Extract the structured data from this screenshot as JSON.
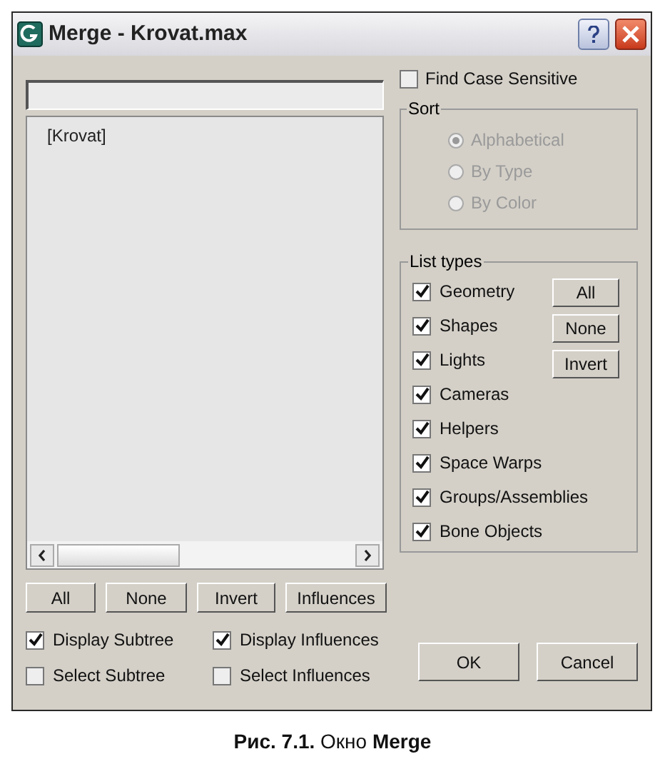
{
  "window": {
    "title": "Merge - Krovat.max"
  },
  "objects": [
    {
      "label": "[Krovat]",
      "selected": false
    }
  ],
  "find_case_sensitive": {
    "label": "Find Case Sensitive",
    "checked": false
  },
  "sort": {
    "title": "Sort",
    "disabled": true,
    "options": [
      {
        "label": "Alphabetical",
        "selected": true
      },
      {
        "label": "By Type",
        "selected": false
      },
      {
        "label": "By Color",
        "selected": false
      }
    ]
  },
  "list_types": {
    "title": "List types",
    "items": [
      {
        "label": "Geometry",
        "checked": true
      },
      {
        "label": "Shapes",
        "checked": true
      },
      {
        "label": "Lights",
        "checked": true
      },
      {
        "label": "Cameras",
        "checked": true
      },
      {
        "label": "Helpers",
        "checked": true
      },
      {
        "label": "Space Warps",
        "checked": true
      },
      {
        "label": "Groups/Assemblies",
        "checked": true
      },
      {
        "label": "Bone Objects",
        "checked": true
      }
    ],
    "buttons": [
      "All",
      "None",
      "Invert"
    ]
  },
  "list_buttons": [
    "All",
    "None",
    "Invert",
    "Influences"
  ],
  "options": [
    {
      "label": "Display Subtree",
      "checked": true
    },
    {
      "label": "Display Influences",
      "checked": true
    },
    {
      "label": "Select Subtree",
      "checked": false
    },
    {
      "label": "Select Influences",
      "checked": false
    }
  ],
  "dialog_buttons": [
    "OK",
    "Cancel"
  ],
  "caption": "**Рис. 7.1.** Окно **Merge**"
}
